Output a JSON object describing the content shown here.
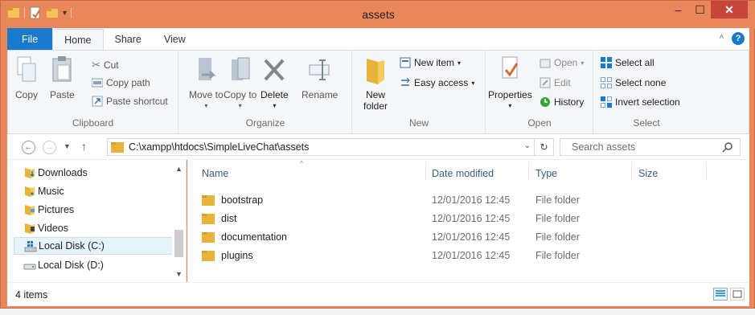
{
  "window": {
    "title": "assets",
    "minimize_label": "–",
    "maximize_label": "☐",
    "close_label": "✕"
  },
  "ribbon_tabs": {
    "file": "File",
    "home": "Home",
    "share": "Share",
    "view": "View"
  },
  "ribbon": {
    "clipboard": {
      "label": "Clipboard",
      "copy": "Copy",
      "paste": "Paste",
      "cut": "Cut",
      "copy_path": "Copy path",
      "paste_shortcut": "Paste shortcut"
    },
    "organize": {
      "label": "Organize",
      "move_to": "Move to",
      "copy_to": "Copy to",
      "delete": "Delete",
      "rename": "Rename"
    },
    "new": {
      "label": "New",
      "new_folder": "New folder",
      "new_item": "New item",
      "easy_access": "Easy access"
    },
    "open": {
      "label": "Open",
      "properties": "Properties",
      "open": "Open",
      "edit": "Edit",
      "history": "History"
    },
    "select": {
      "label": "Select",
      "select_all": "Select all",
      "select_none": "Select none",
      "invert_selection": "Invert selection"
    }
  },
  "address": {
    "path": "C:\\xampp\\htdocs\\SimpleLiveChat\\assets",
    "search_placeholder": "Search assets"
  },
  "nav_pane": {
    "items": [
      {
        "label": "Downloads",
        "icon": "downloads-folder-icon"
      },
      {
        "label": "Music",
        "icon": "music-folder-icon"
      },
      {
        "label": "Pictures",
        "icon": "pictures-folder-icon"
      },
      {
        "label": "Videos",
        "icon": "videos-folder-icon"
      },
      {
        "label": "Local Disk (C:)",
        "icon": "windows-drive-icon",
        "selected": true
      },
      {
        "label": "Local Disk (D:)",
        "icon": "drive-icon"
      }
    ]
  },
  "file_list": {
    "columns": {
      "name": "Name",
      "date": "Date modified",
      "type": "Type",
      "size": "Size"
    },
    "rows": [
      {
        "name": "bootstrap",
        "date": "12/01/2016 12:45",
        "type": "File folder"
      },
      {
        "name": "dist",
        "date": "12/01/2016 12:45",
        "type": "File folder"
      },
      {
        "name": "documentation",
        "date": "12/01/2016 12:45",
        "type": "File folder"
      },
      {
        "name": "plugins",
        "date": "12/01/2016 12:45",
        "type": "File folder"
      }
    ]
  },
  "status_bar": {
    "item_count": "4 items"
  },
  "colors": {
    "titlebar": "#e9875b",
    "file_tab": "#1979ca",
    "close_button": "#c7463c",
    "folder": "#e8b33a"
  }
}
